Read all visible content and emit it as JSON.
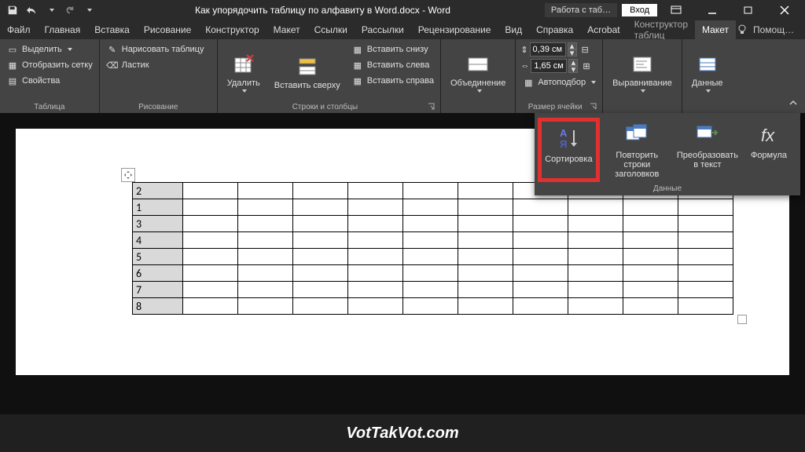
{
  "title": "Как упорядочить таблицу по алфавиту в Word.docx  -  Word",
  "table_tools_label": "Работа с таб…",
  "login_label": "Вход",
  "tabs": {
    "file": "Файл",
    "home": "Главная",
    "insert": "Вставка",
    "draw": "Рисование",
    "design": "Конструктор",
    "layout": "Макет",
    "references": "Ссылки",
    "mailings": "Рассылки",
    "review": "Рецензирование",
    "view": "Вид",
    "help": "Справка",
    "acrobat": "Acrobat",
    "table_design": "Конструктор таблиц",
    "table_layout": "Макет"
  },
  "tell_me": "Помощ…",
  "ribbon": {
    "table_group": {
      "select": "Выделить",
      "gridlines": "Отобразить сетку",
      "properties": "Свойства",
      "label": "Таблица"
    },
    "draw_group": {
      "draw": "Нарисовать таблицу",
      "eraser": "Ластик",
      "label": "Рисование"
    },
    "rows_cols_group": {
      "delete": "Удалить",
      "insert_above": "Вставить сверху",
      "insert_below": "Вставить снизу",
      "insert_left": "Вставить слева",
      "insert_right": "Вставить справа",
      "label": "Строки и столбцы"
    },
    "merge_group": {
      "label": "Объединение"
    },
    "size_group": {
      "height": "0,39 см",
      "width": "1,65 см",
      "autofit": "Автоподбор",
      "label": "Размер ячейки"
    },
    "align_group": {
      "label": "Выравнивание"
    },
    "data_group": {
      "label": "Данные"
    }
  },
  "dropdown": {
    "sort": "Сортировка",
    "repeat_headers_l1": "Повторить строки",
    "repeat_headers_l2": "заголовков",
    "convert_l1": "Преобразовать",
    "convert_l2": "в текст",
    "formula": "Формула",
    "label": "Данные"
  },
  "doc_table": {
    "cols": 11,
    "rows": [
      "2",
      "1",
      "3",
      "4",
      "5",
      "6",
      "7",
      "8"
    ]
  },
  "footer": "VotTakVot.com"
}
